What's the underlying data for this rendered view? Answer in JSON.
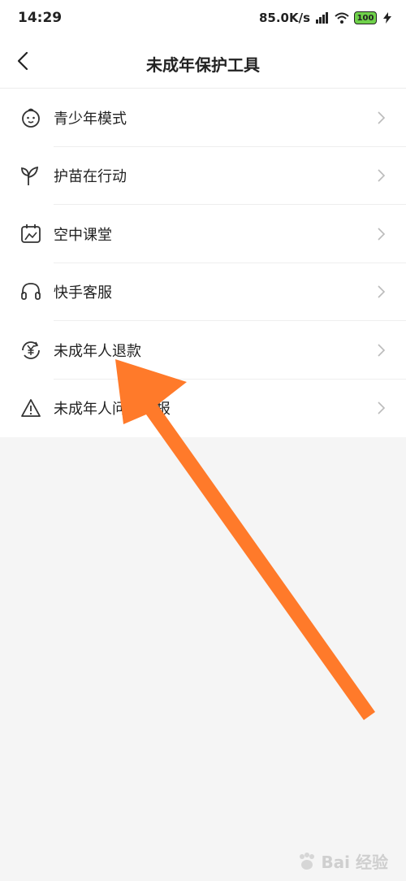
{
  "status_bar": {
    "time": "14:29",
    "net_speed": "85.0K/s",
    "battery": "100"
  },
  "header": {
    "title": "未成年保护工具"
  },
  "menu": {
    "items": [
      {
        "label": "青少年模式",
        "icon": "child-face-icon"
      },
      {
        "label": "护苗在行动",
        "icon": "sprout-icon"
      },
      {
        "label": "空中课堂",
        "icon": "classroom-icon"
      },
      {
        "label": "快手客服",
        "icon": "headset-icon"
      },
      {
        "label": "未成年人退款",
        "icon": "yuan-refund-icon"
      },
      {
        "label": "未成年人问题举报",
        "icon": "warning-icon"
      }
    ]
  },
  "colors": {
    "arrow": "#ff7a2a",
    "background": "#f5f5f5"
  },
  "watermark": {
    "text": "Bai 经验"
  }
}
